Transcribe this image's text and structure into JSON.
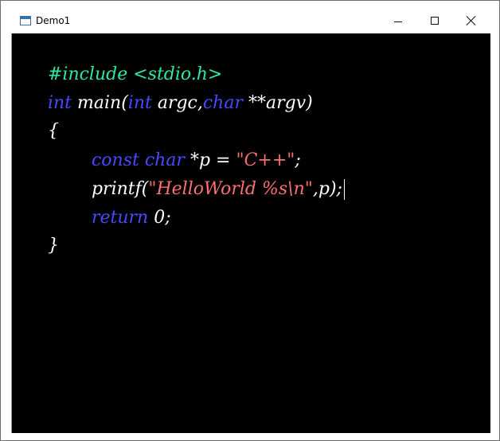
{
  "window": {
    "title": "Demo1",
    "colors": {
      "editor_background": "#000000",
      "preprocessor": "#2ee8a0",
      "keyword": "#4a48ff",
      "identifier": "#ffffff",
      "string": "#ff6f6f"
    },
    "controls": {
      "minimize_icon": "minimize-icon",
      "maximize_icon": "maximize-icon",
      "close_icon": "close-icon"
    }
  },
  "editor": {
    "lines": [
      {
        "tokens": [
          {
            "type": "preprocessor",
            "text": "#include <stdio.h>"
          }
        ]
      },
      {
        "tokens": [
          {
            "type": "keyword",
            "text": "int"
          },
          {
            "type": "identifier",
            "text": " main("
          },
          {
            "type": "keyword",
            "text": "int"
          },
          {
            "type": "identifier",
            "text": " argc,"
          },
          {
            "type": "keyword",
            "text": "char"
          },
          {
            "type": "identifier",
            "text": " **argv)"
          }
        ]
      },
      {
        "tokens": [
          {
            "type": "identifier",
            "text": "{"
          }
        ]
      },
      {
        "tokens": [
          {
            "type": "keyword",
            "text": "const char"
          },
          {
            "type": "identifier",
            "text": " *p = "
          },
          {
            "type": "string",
            "text": "\"C++\""
          },
          {
            "type": "identifier",
            "text": ";"
          }
        ]
      },
      {
        "tokens": [
          {
            "type": "identifier",
            "text": "printf("
          },
          {
            "type": "string",
            "text": "\"HelloWorld %s\\n\""
          },
          {
            "type": "identifier",
            "text": ",p);"
          }
        ]
      },
      {
        "tokens": [
          {
            "type": "keyword",
            "text": "return"
          },
          {
            "type": "identifier",
            "text": " 0;"
          }
        ]
      },
      {
        "tokens": [
          {
            "type": "identifier",
            "text": "}"
          }
        ]
      }
    ]
  }
}
